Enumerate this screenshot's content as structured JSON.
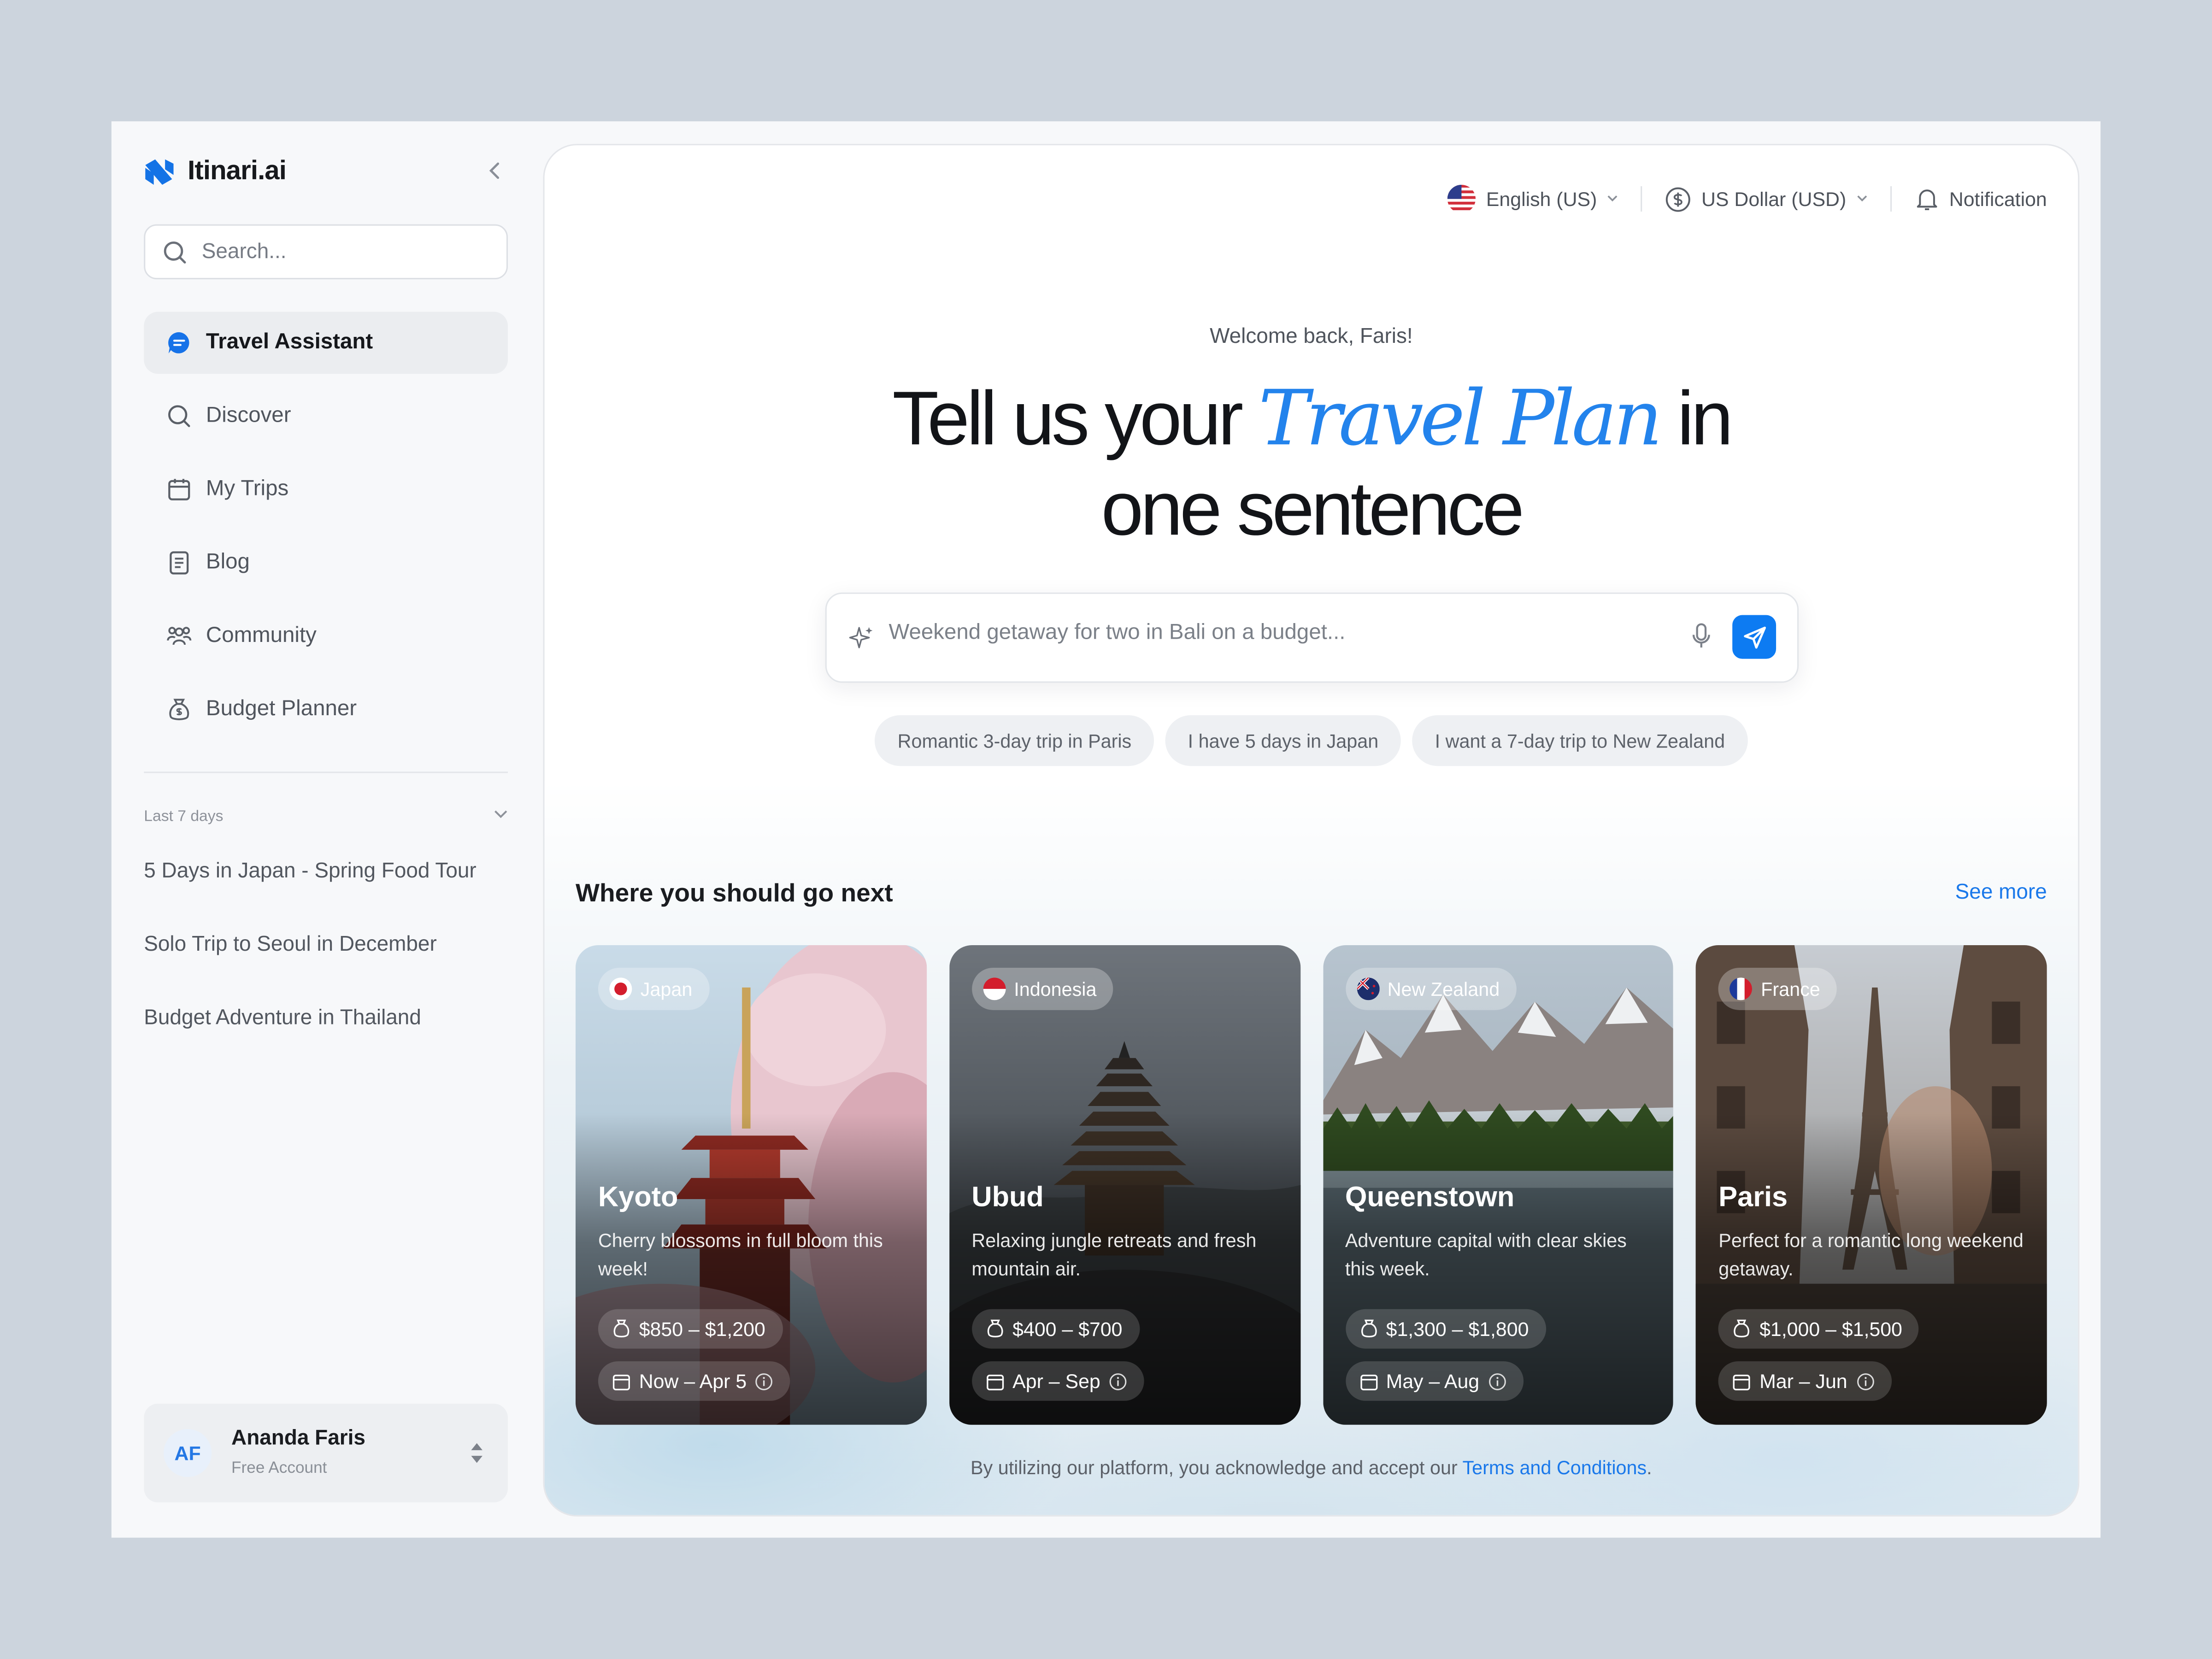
{
  "app": {
    "name": "Itinari.ai"
  },
  "search": {
    "placeholder": "Search..."
  },
  "nav": [
    {
      "label": "Travel Assistant",
      "icon": "chat-bubble-icon",
      "active": true
    },
    {
      "label": "Discover",
      "icon": "search-icon"
    },
    {
      "label": "My Trips",
      "icon": "calendar-icon"
    },
    {
      "label": "Blog",
      "icon": "document-icon"
    },
    {
      "label": "Community",
      "icon": "people-icon"
    },
    {
      "label": "Budget Planner",
      "icon": "money-bag-icon"
    }
  ],
  "recent": {
    "heading": "Last 7 days",
    "items": [
      "5 Days in Japan - Spring Food Tour",
      "Solo Trip to Seoul in December",
      "Budget Adventure in Thailand"
    ]
  },
  "user": {
    "initials": "AF",
    "name": "Ananda Faris",
    "plan": "Free Account"
  },
  "topbar": {
    "language": "English (US)",
    "currency": "US Dollar (USD)",
    "notification": "Notification"
  },
  "hero": {
    "welcome": "Welcome back, Faris!",
    "title_pre": "Tell us your ",
    "title_accent": "Travel Plan",
    "title_post": " in",
    "title_line2": "one sentence"
  },
  "prompt": {
    "placeholder": "Weekend getaway for two in Bali on a budget..."
  },
  "suggestions": [
    "Romantic 3-day trip in Paris",
    "I have 5 days in Japan",
    "I want a 7-day trip to New Zealand"
  ],
  "section": {
    "title": "Where you should go next",
    "see_more": "See more"
  },
  "destinations": [
    {
      "country": "Japan",
      "city": "Kyoto",
      "description": "Cherry blossoms in full bloom this week!",
      "price": "$850 – $1,200",
      "dates": "Now – Apr 5"
    },
    {
      "country": "Indonesia",
      "city": "Ubud",
      "description": "Relaxing jungle retreats and fresh mountain air.",
      "price": "$400 – $700",
      "dates": "Apr – Sep"
    },
    {
      "country": "New Zealand",
      "city": "Queenstown",
      "description": "Adventure capital with clear skies this week.",
      "price": "$1,300 – $1,800",
      "dates": "May – Aug"
    },
    {
      "country": "France",
      "city": "Paris",
      "description": "Perfect for a romantic long weekend getaway.",
      "price": "$1,000 – $1,500",
      "dates": "Mar – Jun"
    }
  ],
  "footer": {
    "text": "By utilizing our platform, you acknowledge and accept our ",
    "link": "Terms and Conditions",
    "end": "."
  },
  "colors": {
    "accent": "#0d7bf2",
    "background": "#ccd4dd"
  }
}
